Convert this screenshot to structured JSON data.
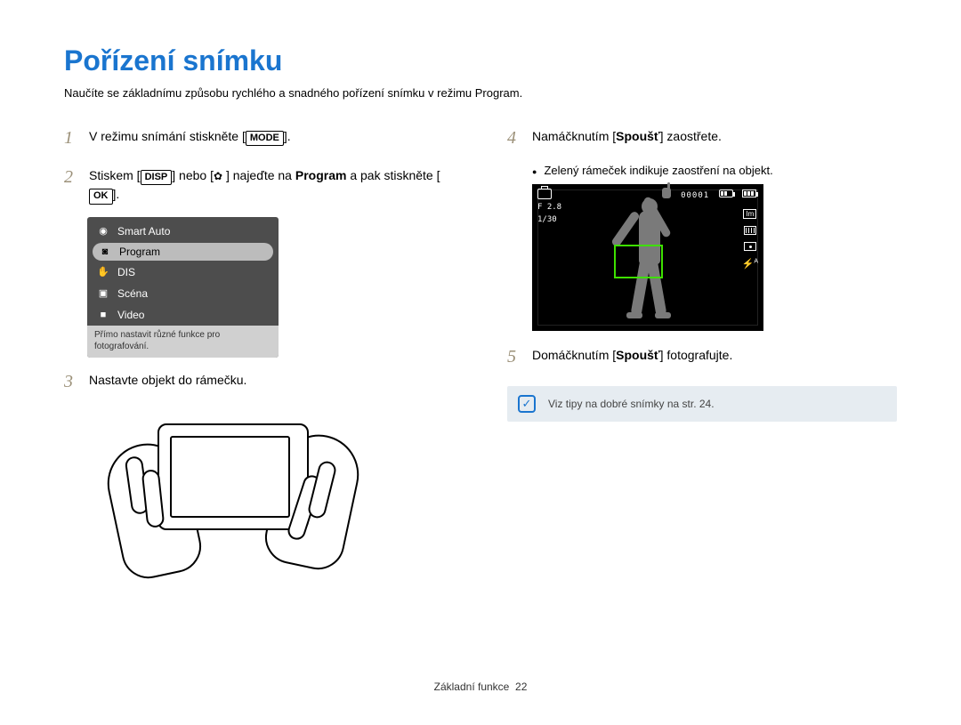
{
  "title": "Pořízení snímku",
  "subtitle": "Naučíte se základnímu způsobu rychlého a snadného pořízení snímku v režimu Program.",
  "steps": {
    "s1": {
      "num": "1",
      "pre": "V režimu snímání stiskněte [",
      "btn": "MODE",
      "post": "]."
    },
    "s2": {
      "num": "2",
      "pre": "Stiskem [",
      "btn1": "DISP",
      "mid1": "] nebo [",
      "mid2": "] najeďte na ",
      "program": "Program",
      "mid3": " a pak stiskněte [",
      "btn2": "OK",
      "post": "]."
    },
    "s3": {
      "num": "3",
      "text": "Nastavte objekt do rámečku."
    },
    "s4": {
      "num": "4",
      "pre": "Namáčknutím [",
      "btn": "Spoušť",
      "post": "] zaostřete."
    },
    "s4_bullet": "Zelený rámeček indikuje zaostření na objekt.",
    "s5": {
      "num": "5",
      "pre": "Domáčknutím [",
      "btn": "Spoušť",
      "post": "] fotografujte."
    }
  },
  "mode_menu": {
    "items": [
      "Smart Auto",
      "Program",
      "DIS",
      "Scéna",
      "Video"
    ],
    "selected_index": 1,
    "desc": "Přímo nastavit různé funkce pro fotografování."
  },
  "lcd": {
    "counter": "00001",
    "fnum": "F 2.8",
    "shutter": "1/30",
    "size_label": "Im",
    "flash_label": "A"
  },
  "tip": "Viz tipy na dobré snímky na str. 24.",
  "footer": {
    "section": "Základní funkce",
    "page": "22"
  }
}
